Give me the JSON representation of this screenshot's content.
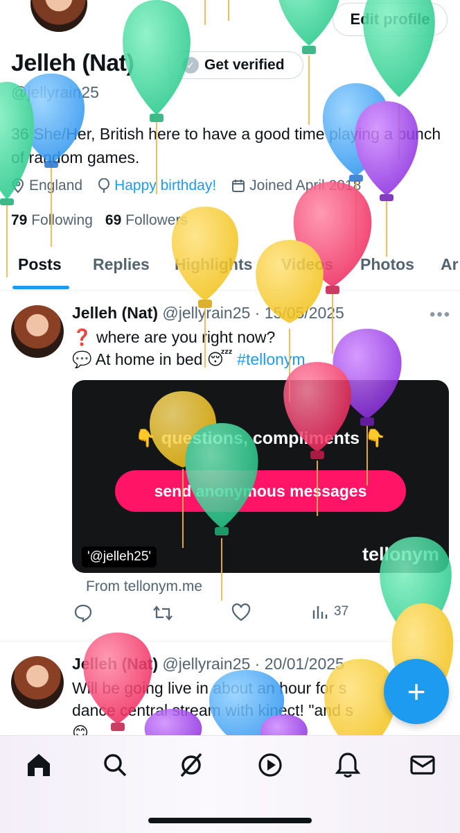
{
  "profile": {
    "name": "Jelleh (Nat)",
    "handle": "@jellyrain25",
    "edit_label": "Edit profile",
    "verify_label": "Get verified",
    "bio": "36 She/Her, British here to have a good time playing a bunch of random games.",
    "location": "England",
    "birthday": "Happy birthday!",
    "joined": "Joined April 2018",
    "following_count": "79",
    "following_label": "Following",
    "followers_count": "69",
    "followers_label": "Followers"
  },
  "tabs": [
    "Posts",
    "Replies",
    "Highlights",
    "Videos",
    "Photos",
    "Ar"
  ],
  "posts": [
    {
      "name": "Jelleh (Nat)",
      "meta": "@jellyrain25 · 15/05/2025",
      "line1": "❓ where are you right now?",
      "line2_text": "💬 At home in bed 😴 ",
      "hashtag": "#tellonym",
      "card": {
        "question": "👇 questions, compliments 👇",
        "button": "send anonymous messages",
        "tag": "'@jelleh25'",
        "brand": "tellonym"
      },
      "source": "From tellonym.me",
      "views": "37"
    },
    {
      "name": "Jelleh (Nat)",
      "meta": "@jellyrain25 · 20/01/2025",
      "line1": "Will be going live in about an hour for s",
      "line2": "dance central stream with kinect! \"and s",
      "line3": "😊"
    }
  ],
  "icons": {
    "location": "location-icon",
    "birthday": "balloon-icon",
    "calendar": "calendar-icon",
    "reply": "reply-icon",
    "repost": "repost-icon",
    "like": "heart-icon",
    "views": "views-icon",
    "home": "home-icon",
    "search": "search-icon",
    "grok": "grok-icon",
    "video": "play-icon",
    "notifications": "bell-icon",
    "messages": "mail-icon",
    "compose": "plus-icon"
  },
  "colors": {
    "accent": "#1d9bf0",
    "text": "#0f1419",
    "muted": "#536471",
    "tellonym_pink": "#ff1466"
  }
}
